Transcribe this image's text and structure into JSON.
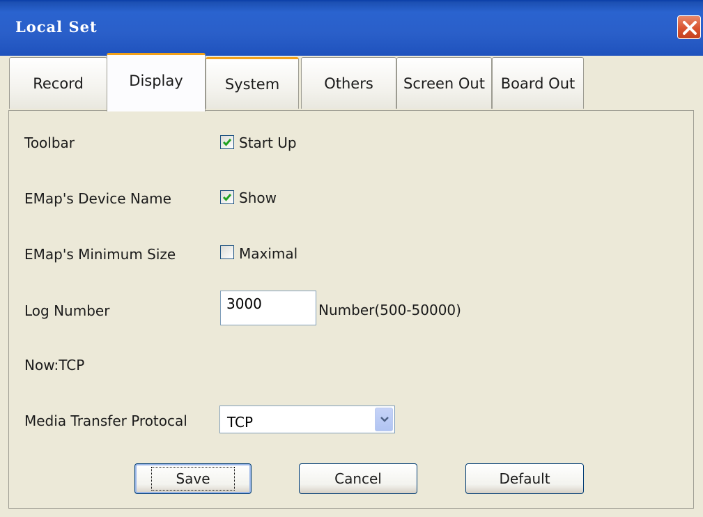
{
  "window": {
    "title": "Local Set"
  },
  "tabs": [
    {
      "label": "Record"
    },
    {
      "label": "Display"
    },
    {
      "label": "System"
    },
    {
      "label": "Others"
    },
    {
      "label": "Screen Out"
    },
    {
      "label": "Board Out"
    }
  ],
  "active_tab": "Display",
  "form": {
    "toolbar": {
      "label": "Toolbar",
      "checkbox_label": "Start Up",
      "checked": true
    },
    "emap_device_name": {
      "label": "EMap's Device Name",
      "checkbox_label": "Show",
      "checked": true
    },
    "emap_min_size": {
      "label": "EMap's Minimum Size",
      "checkbox_label": "Maximal",
      "checked": false
    },
    "log_number": {
      "label": "Log Number",
      "value": "3000",
      "hint": "Number(500-50000)"
    },
    "now_protocol": "Now:TCP",
    "media_protocol": {
      "label": "Media Transfer Protocal",
      "selected": "TCP"
    }
  },
  "buttons": {
    "save": "Save",
    "cancel": "Cancel",
    "default": "Default"
  },
  "colors": {
    "titlebar": "#2a5fc9",
    "panel": "#ece9d8",
    "tab_highlight": "#f2a11a",
    "close": "#d9532f"
  },
  "icons": {
    "close": "close-icon",
    "check": "check-icon",
    "dropdown": "chevron-down-icon"
  }
}
